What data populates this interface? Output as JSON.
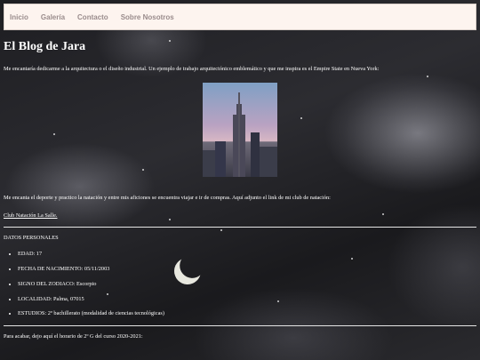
{
  "nav": {
    "items": [
      "Inicio",
      "Galería",
      "Contacto",
      "Sobre Nosotros"
    ]
  },
  "blog": {
    "title": "El Blog de Jara",
    "intro": "Me encantaría dedicarme a la arquitectura o el diseño industrial. Un ejemplo de trabajo arquitectónico emblemático y que me inspira es el Empire State en Nueva York:",
    "hobbies": "Me encanta el deporte y practico la natación y entre mis aficiones se encuentra viajar e ir de compras. Aquí adjunto el link de mi club de natación:",
    "club_link": "Club Natación La Salle."
  },
  "personal": {
    "title": "DATOS PERSONALES",
    "items": [
      "EDAD: 17",
      "FECHA DE NACIMIENTO: 05/11/2003",
      "SIGNO DEL ZODIACO: Escorpio",
      "LOCALIDAD: Palma, 07015",
      "ESTUDIOS: 2º bachillerato (modalidad de ciencias tecnológicas)"
    ]
  },
  "footer_text": "Para acabar, dejo aquí el horario de 2º G del curso 2020-2021:"
}
